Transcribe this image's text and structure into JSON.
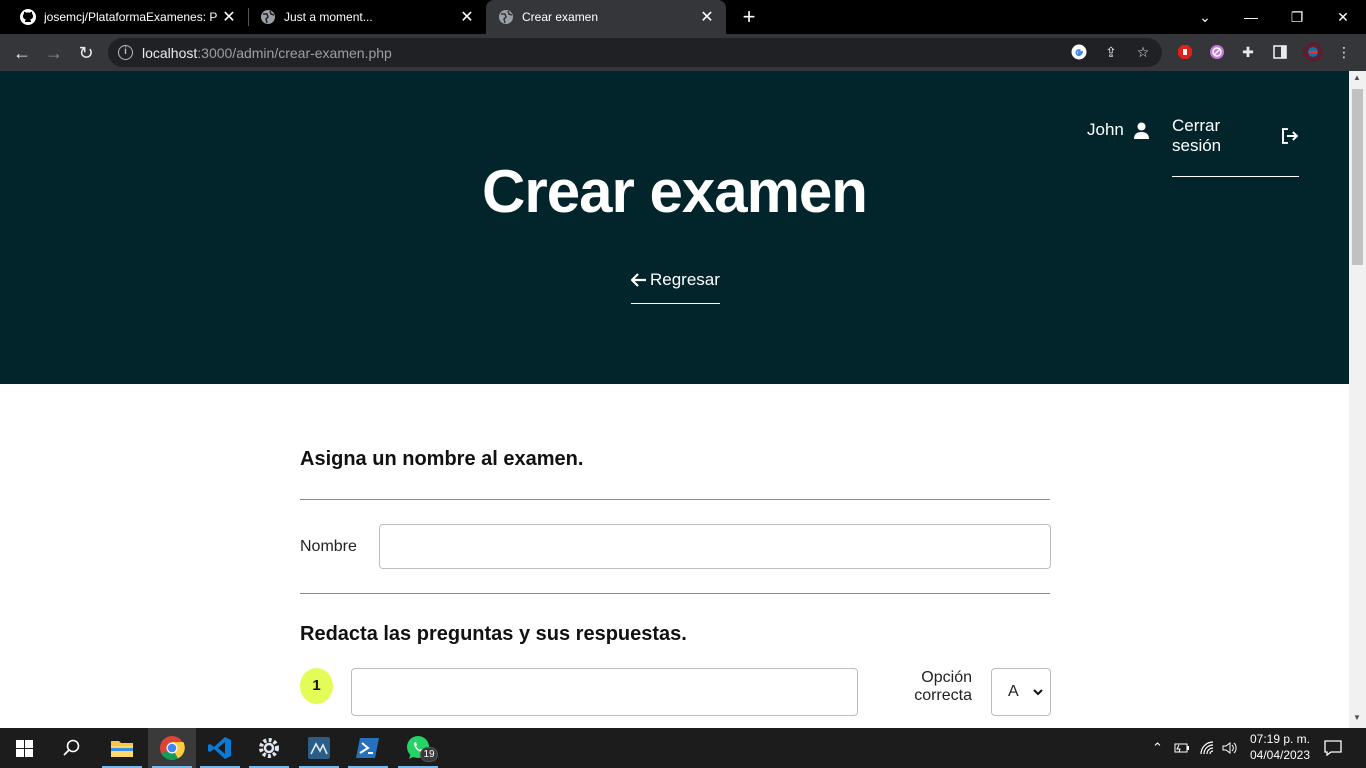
{
  "browser": {
    "tabs": [
      {
        "title": "josemcj/PlataformaExamenes: Pla",
        "icon": "github-icon"
      },
      {
        "title": "Just a moment...",
        "icon": "globe-icon"
      },
      {
        "title": "Crear examen",
        "icon": "globe-icon",
        "active": true
      }
    ],
    "url_host": "localhost",
    "url_rest": ":3000/admin/crear-examen.php"
  },
  "header": {
    "title": "Crear examen",
    "user_name": "John",
    "logout_label": "Cerrar sesión",
    "back_label": "Regresar",
    "bg_color": "#02252c"
  },
  "form": {
    "name_section_title": "Asigna un nombre al examen.",
    "name_label": "Nombre",
    "name_value": "",
    "questions_section_title": "Redacta las preguntas y sus respuestas.",
    "questions": [
      {
        "number": "1",
        "text": "",
        "correct_label_line1": "Opción",
        "correct_label_line2": "correcta",
        "correct_option": "A"
      }
    ],
    "accent_color": "#e3fc58"
  },
  "taskbar": {
    "apps": [
      "windows-start",
      "search",
      "file-explorer",
      "chrome",
      "vscode",
      "settings",
      "mysql-workbench",
      "powershell",
      "whatsapp"
    ],
    "whatsapp_badge": "19",
    "time": "07:19 p. m.",
    "date": "04/04/2023"
  }
}
